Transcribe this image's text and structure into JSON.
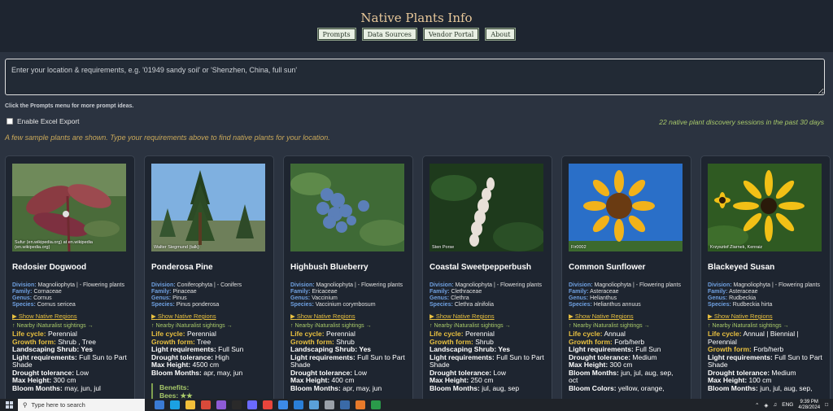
{
  "site": {
    "title": "Native Plants Info"
  },
  "nav": [
    {
      "label": "Prompts"
    },
    {
      "label": "Data Sources"
    },
    {
      "label": "Vendor Portal"
    },
    {
      "label": "About"
    }
  ],
  "search": {
    "placeholder": "Enter your location & requirements, e.g. '01949 sandy soil' or 'Shenzhen, China, full sun'",
    "value": ""
  },
  "hint": "Click the Prompts menu for more prompt ideas.",
  "excel_label": "Enable Excel Export",
  "sessions_text": "22 native plant discovery sessions in the past 30 days",
  "sample_note": "A few sample plants are shown. Type your requirements above to find native plants for your location.",
  "labels": {
    "division": "Division:",
    "family": "Family:",
    "genus": "Genus:",
    "species": "Species:",
    "show_regions": "Show Native Regions",
    "sightings": "Nearby iNaturalist sightings →",
    "arrow_down": "▶",
    "arrow_up": "↑"
  },
  "plants": [
    {
      "credit": "Sufur (en.wikipedia.org) at en.wikipedia (en.wikipedia.org)",
      "name": "Redosier Dogwood",
      "division": "Magnoliophyta | - Flowering plants",
      "family": "Cornaceae",
      "genus": "Cornus",
      "species": "Cornus sericea",
      "facts": [
        {
          "k": "Life cycle:",
          "v": " Perennial",
          "lc": true
        },
        {
          "k": "Growth form:",
          "v": " Shrub , Tree",
          "lc": true
        },
        {
          "k": "Landscaping Shrub:",
          "v": " Yes"
        },
        {
          "k": "Light requirements:",
          "v": " Full Sun to Part Shade"
        },
        {
          "k": "Drought tolerance:",
          "v": " Low"
        },
        {
          "k": "Max Height:",
          "v": " 300 cm"
        },
        {
          "k": "Bloom Months:",
          "v": " may, jun, jul"
        }
      ]
    },
    {
      "credit": "Walter Siegmund (talk)",
      "name": "Ponderosa Pine",
      "division": "Coniferophyta | - Conifers",
      "family": "Pinaceae",
      "genus": "Pinus",
      "species": "Pinus ponderosa",
      "facts": [
        {
          "k": "Life cycle:",
          "v": " Perennial",
          "lc": true
        },
        {
          "k": "Growth form:",
          "v": " Tree",
          "lc": true
        },
        {
          "k": "Light requirements:",
          "v": " Full Sun"
        },
        {
          "k": "Drought tolerance:",
          "v": " High"
        },
        {
          "k": "Max Height:",
          "v": " 4500 cm"
        },
        {
          "k": "Bloom Months:",
          "v": " apr, may, jun"
        }
      ],
      "benefits_title": "Benefits:",
      "benefits_bees": "Bees: ★★"
    },
    {
      "credit": "",
      "name": "Highbush Blueberry",
      "division": "Magnoliophyta | - Flowering plants",
      "family": "Ericaceae",
      "genus": "Vaccinium",
      "species": "Vaccinium corymbosum",
      "facts": [
        {
          "k": "Life cycle:",
          "v": " Perennial",
          "lc": true
        },
        {
          "k": "Growth form:",
          "v": " Shrub",
          "lc": true
        },
        {
          "k": "Landscaping Shrub:",
          "v": " Yes"
        },
        {
          "k": "Light requirements:",
          "v": " Full Sun to Part Shade"
        },
        {
          "k": "Drought tolerance:",
          "v": " Low"
        },
        {
          "k": "Max Height:",
          "v": " 400 cm"
        },
        {
          "k": "Bloom Months:",
          "v": " apr, may, jun"
        }
      ]
    },
    {
      "credit": "Sten Porse",
      "name": "Coastal Sweetpepperbush",
      "division": "Magnoliophyta | - Flowering plants",
      "family": "Clethraceae",
      "genus": "Clethra",
      "species": "Clethra alnifolia",
      "facts": [
        {
          "k": "Life cycle:",
          "v": " Perennial",
          "lc": true
        },
        {
          "k": "Growth form:",
          "v": " Shrub",
          "lc": true
        },
        {
          "k": "Landscaping Shrub:",
          "v": " Yes"
        },
        {
          "k": "Light requirements:",
          "v": " Full Sun to Part Shade"
        },
        {
          "k": "Drought tolerance:",
          "v": " Low"
        },
        {
          "k": "Max Height:",
          "v": " 250 cm"
        },
        {
          "k": "Bloom Months:",
          "v": " jul, aug, sep"
        }
      ]
    },
    {
      "credit": "Fir0002",
      "name": "Common Sunflower",
      "division": "Magnoliophyta | - Flowering plants",
      "family": "Asteraceae",
      "genus": "Helianthus",
      "species": "Helianthus annuus",
      "facts": [
        {
          "k": "Life cycle:",
          "v": " Annual",
          "lc": true
        },
        {
          "k": "Growth form:",
          "v": " Forb/herb",
          "lc": true
        },
        {
          "k": "Light requirements:",
          "v": " Full Sun"
        },
        {
          "k": "Drought tolerance:",
          "v": " Medium"
        },
        {
          "k": "Max Height:",
          "v": " 300 cm"
        },
        {
          "k": "Bloom Months:",
          "v": " jun, jul, aug, sep, oct"
        },
        {
          "k": "Bloom Colors:",
          "v": " yellow, orange,"
        }
      ]
    },
    {
      "credit": "Krzysztof Ziarnek, Kenraiz",
      "name": "Blackeyed Susan",
      "division": "Magnoliophyta | - Flowering plants",
      "family": "Asteraceae",
      "genus": "Rudbeckia",
      "species": "Rudbeckia hirta",
      "facts": [
        {
          "k": "Life cycle:",
          "v": " Annual | Biennial | Perennial",
          "lc": true
        },
        {
          "k": "Growth form:",
          "v": " Forb/herb",
          "lc": true
        },
        {
          "k": "Light requirements:",
          "v": " Full Sun to Part Shade"
        },
        {
          "k": "Drought tolerance:",
          "v": " Medium"
        },
        {
          "k": "Max Height:",
          "v": " 100 cm"
        },
        {
          "k": "Bloom Months:",
          "v": " jun, jul, aug, sep,"
        }
      ]
    }
  ],
  "taskbar": {
    "search_placeholder": "Type here to search",
    "lang": "ENG",
    "time": "9:39 PM",
    "date": "4/28/2024"
  }
}
